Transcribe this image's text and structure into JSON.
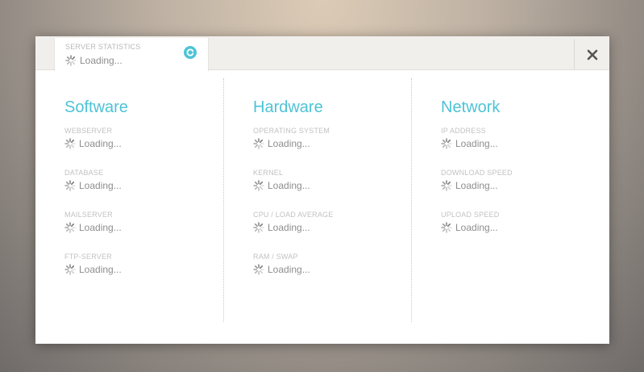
{
  "tab": {
    "title": "SERVER STATISTICS",
    "status": "Loading..."
  },
  "colors": {
    "accent": "#4ec3d6",
    "label": "#c2c2c2",
    "value": "#8e8e8e"
  },
  "icons": {
    "refresh": "refresh-icon",
    "close": "close-icon",
    "spinner": "spinner-icon"
  },
  "software": {
    "title": "Software",
    "fields": [
      {
        "label": "WEBSERVER",
        "value": "Loading..."
      },
      {
        "label": "DATABASE",
        "value": "Loading..."
      },
      {
        "label": "MAILSERVER",
        "value": "Loading..."
      },
      {
        "label": "FTP-SERVER",
        "value": "Loading..."
      }
    ]
  },
  "hardware": {
    "title": "Hardware",
    "fields": [
      {
        "label": "OPERATING SYSTEM",
        "value": "Loading..."
      },
      {
        "label": "KERNEL",
        "value": "Loading..."
      },
      {
        "label": "CPU / LOAD AVERAGE",
        "value": "Loading..."
      },
      {
        "label": "RAM / SWAP",
        "value": "Loading..."
      }
    ]
  },
  "network": {
    "title": "Network",
    "fields": [
      {
        "label": "IP ADDRESS",
        "value": "Loading..."
      },
      {
        "label": "DOWNLOAD SPEED",
        "value": "Loading..."
      },
      {
        "label": "UPLOAD SPEED",
        "value": "Loading..."
      }
    ]
  }
}
